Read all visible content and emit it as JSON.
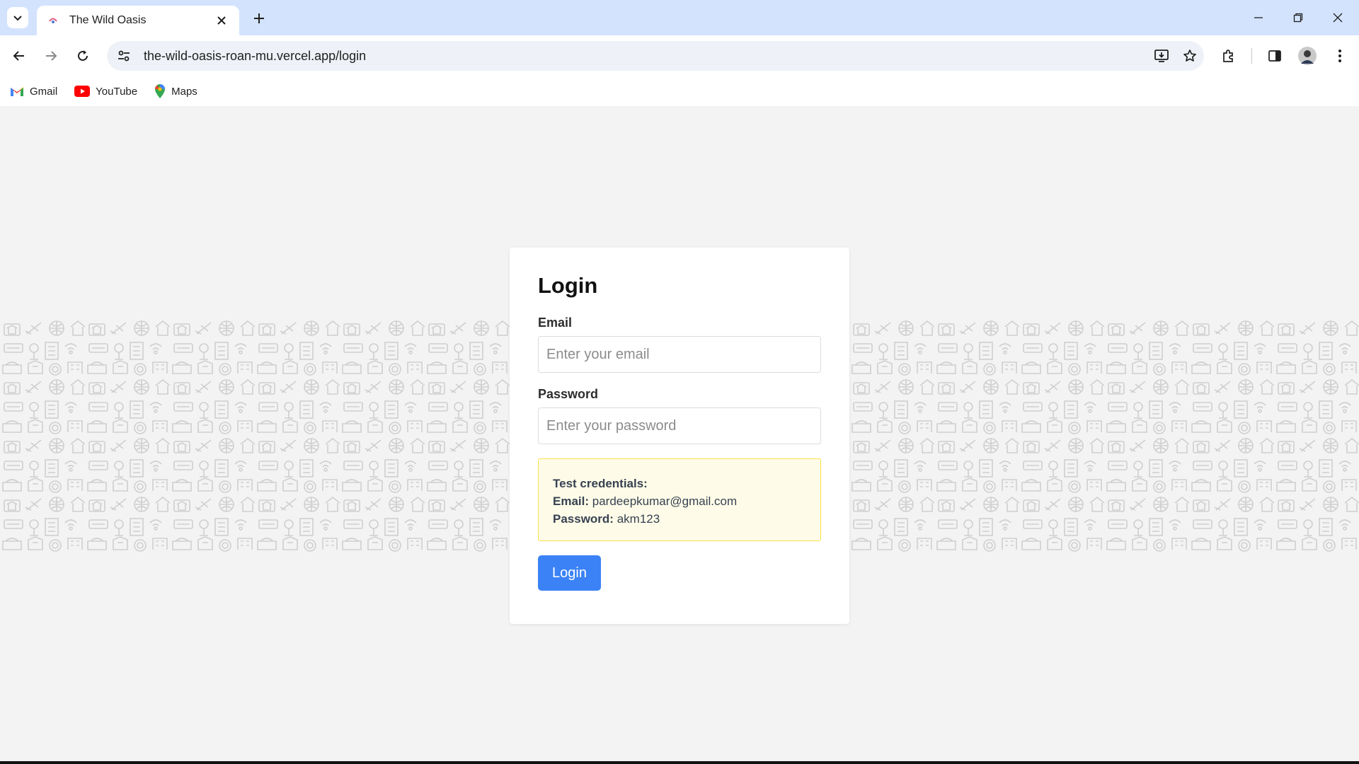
{
  "browser": {
    "tab_title": "The Wild Oasis",
    "url": "the-wild-oasis-roan-mu.vercel.app/login",
    "bookmarks": [
      {
        "label": "Gmail",
        "icon": "gmail-icon"
      },
      {
        "label": "YouTube",
        "icon": "youtube-icon"
      },
      {
        "label": "Maps",
        "icon": "maps-icon"
      }
    ]
  },
  "login": {
    "title": "Login",
    "email_label": "Email",
    "email_placeholder": "Enter your email",
    "email_value": "",
    "password_label": "Password",
    "password_placeholder": "Enter your password",
    "password_value": "",
    "creds_heading": "Test credentials:",
    "creds_email_label": "Email:",
    "creds_email_value": "pardeepkumar@gmail.com",
    "creds_password_label": "Password:",
    "creds_password_value": "akm123",
    "button_label": "Login"
  },
  "colors": {
    "accent": "#3b82f6",
    "tabstrip": "#d3e3fd",
    "creds_bg": "#fefce8",
    "creds_border": "#fde047"
  }
}
